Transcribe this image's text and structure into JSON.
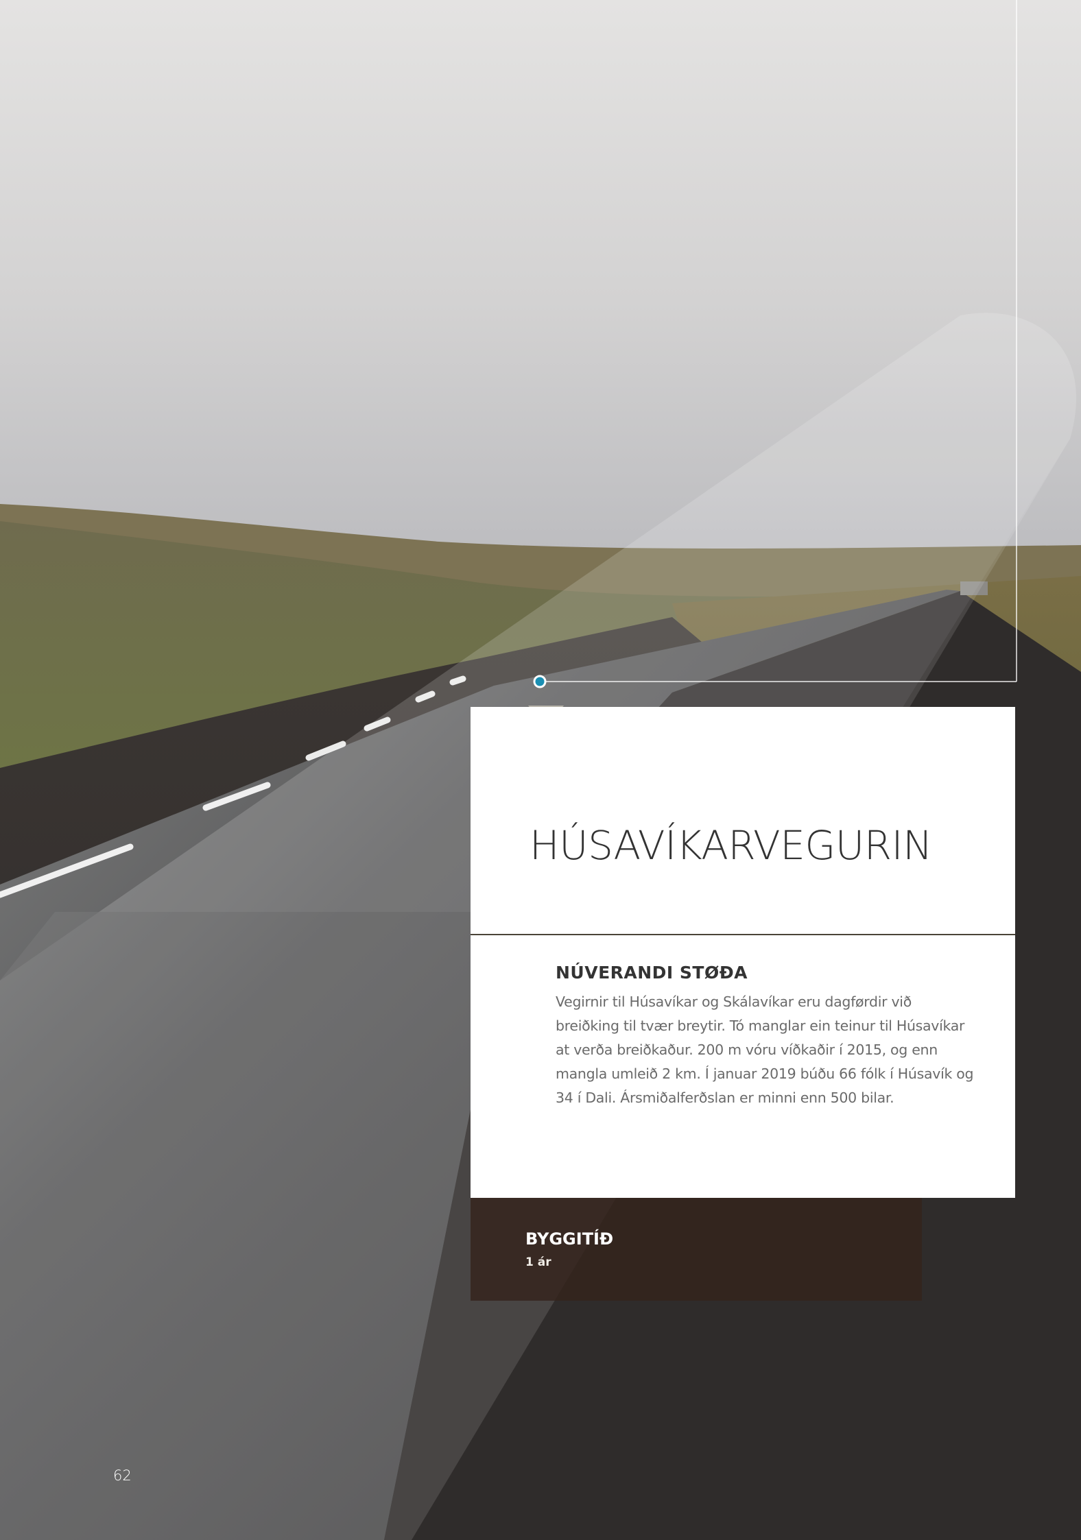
{
  "page": {
    "number": "62"
  },
  "card": {
    "title": "HÚSAVÍKARVEGURIN",
    "section_label": "NÚVERANDI STØÐA",
    "section_body": "Vegirnir til Húsavíkar og Skálavíkar eru dagførdir við breiðking til tvær breytir. Tó manglar ein teinur til Húsavíkar at verða breiðkaður. 200 m vóru víðkaðir í 2015, og enn mangla umleið 2 km. Í januar 2019 búðu 66 fólk í Húsavík og 34 í Dali. Ársmiðalferðslan er minni enn 500 bilar."
  },
  "strip": {
    "label": "BYGGITÍÐ",
    "value": "1 ár"
  },
  "colors": {
    "accent_dot": "#1a8fb3",
    "strip_bg": "#34231c",
    "title_text": "#333333"
  }
}
